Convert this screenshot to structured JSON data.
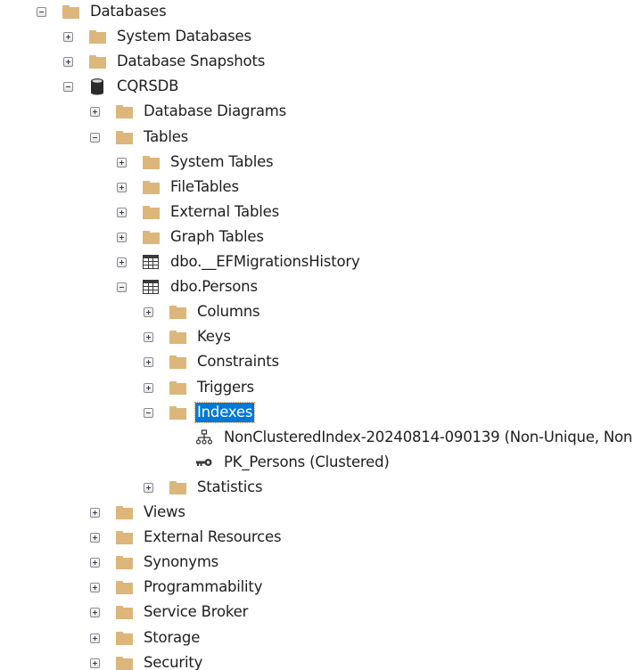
{
  "tree": {
    "nodes": [
      {
        "label": "Databases",
        "state": "expanded",
        "icon": "folder-icon",
        "level": 0
      },
      {
        "label": "System Databases",
        "state": "collapsed",
        "icon": "folder-icon",
        "level": 1
      },
      {
        "label": "Database Snapshots",
        "state": "collapsed",
        "icon": "folder-icon",
        "level": 1
      },
      {
        "label": "CQRSDB",
        "state": "expanded",
        "icon": "database-icon",
        "level": 1
      },
      {
        "label": "Database Diagrams",
        "state": "collapsed",
        "icon": "folder-icon",
        "level": 2
      },
      {
        "label": "Tables",
        "state": "expanded",
        "icon": "folder-icon",
        "level": 2
      },
      {
        "label": "System Tables",
        "state": "collapsed",
        "icon": "folder-icon",
        "level": 3
      },
      {
        "label": "FileTables",
        "state": "collapsed",
        "icon": "folder-icon",
        "level": 3
      },
      {
        "label": "External Tables",
        "state": "collapsed",
        "icon": "folder-icon",
        "level": 3
      },
      {
        "label": "Graph Tables",
        "state": "collapsed",
        "icon": "folder-icon",
        "level": 3
      },
      {
        "label": "dbo.__EFMigrationsHistory",
        "state": "collapsed",
        "icon": "table-icon",
        "level": 3
      },
      {
        "label": "dbo.Persons",
        "state": "expanded",
        "icon": "table-icon",
        "level": 3
      },
      {
        "label": "Columns",
        "state": "collapsed",
        "icon": "folder-icon",
        "level": 4
      },
      {
        "label": "Keys",
        "state": "collapsed",
        "icon": "folder-icon",
        "level": 4
      },
      {
        "label": "Constraints",
        "state": "collapsed",
        "icon": "folder-icon",
        "level": 4
      },
      {
        "label": "Triggers",
        "state": "collapsed",
        "icon": "folder-icon",
        "level": 4
      },
      {
        "label": "Indexes",
        "state": "expanded",
        "icon": "folder-icon",
        "level": 4,
        "selected": true
      },
      {
        "label": "NonClusteredIndex-20240814-090139 (Non-Unique, Non",
        "state": "leaf",
        "icon": "nonclustered-index-icon",
        "level": 5
      },
      {
        "label": "PK_Persons (Clustered)",
        "state": "leaf",
        "icon": "primary-key-icon",
        "level": 5
      },
      {
        "label": "Statistics",
        "state": "collapsed",
        "icon": "folder-icon",
        "level": 4
      },
      {
        "label": "Views",
        "state": "collapsed",
        "icon": "folder-icon",
        "level": 2
      },
      {
        "label": "External Resources",
        "state": "collapsed",
        "icon": "folder-icon",
        "level": 2
      },
      {
        "label": "Synonyms",
        "state": "collapsed",
        "icon": "folder-icon",
        "level": 2
      },
      {
        "label": "Programmability",
        "state": "collapsed",
        "icon": "folder-icon",
        "level": 2
      },
      {
        "label": "Service Broker",
        "state": "collapsed",
        "icon": "folder-icon",
        "level": 2
      },
      {
        "label": "Storage",
        "state": "collapsed",
        "icon": "folder-icon",
        "level": 2
      },
      {
        "label": "Security",
        "state": "collapsed",
        "icon": "folder-icon",
        "level": 2
      }
    ]
  },
  "colors": {
    "folder": "#dcb67a",
    "selection": "#0078d7"
  }
}
